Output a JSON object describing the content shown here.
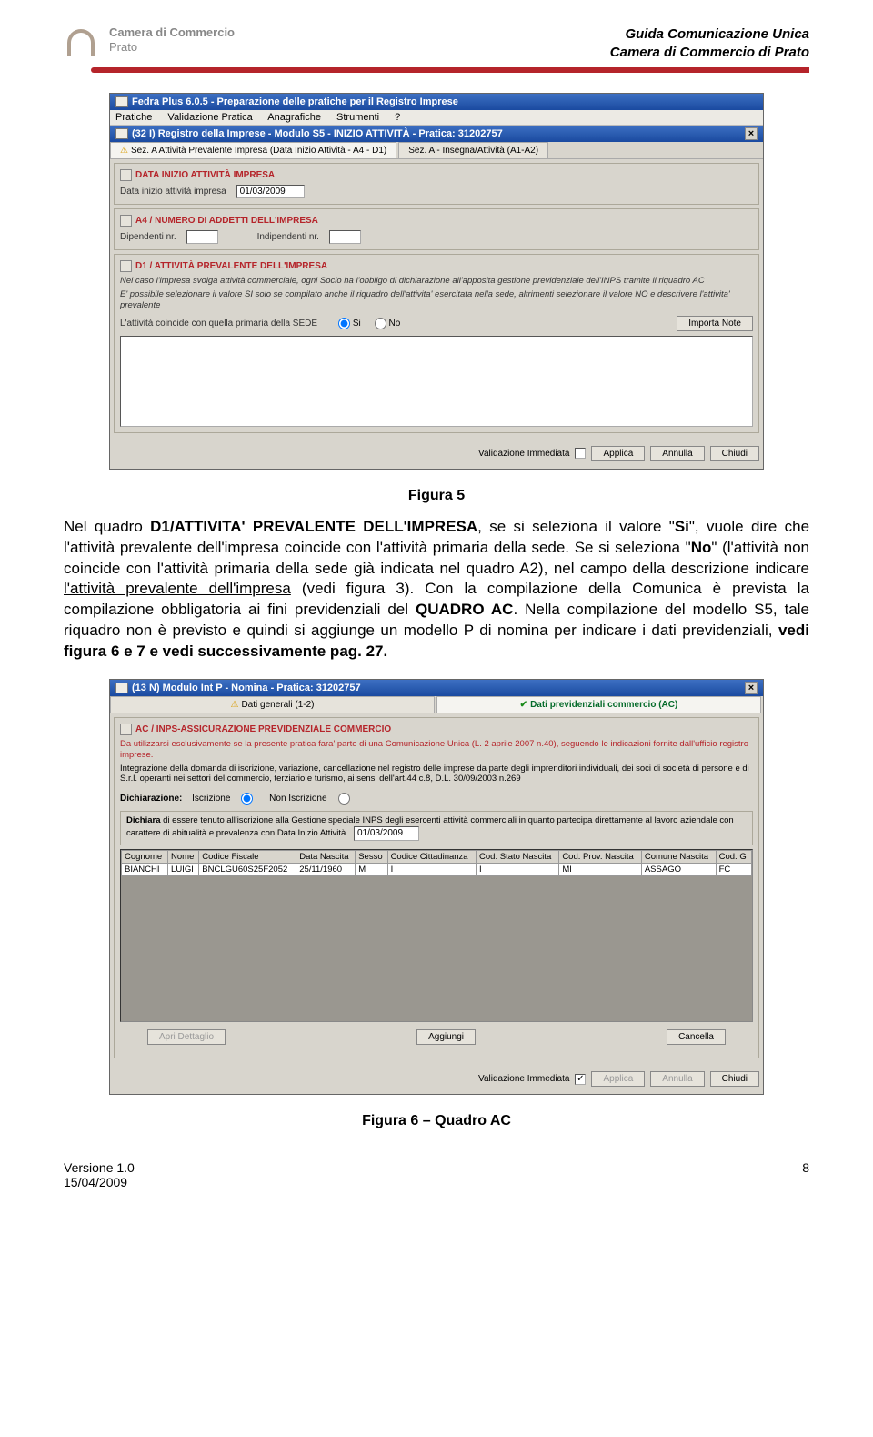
{
  "header": {
    "logo_line1": "Camera di Commercio",
    "logo_line2": "Prato",
    "right_line1": "Guida Comunicazione Unica",
    "right_line2": "Camera di Commercio di Prato"
  },
  "fig5": {
    "win_title": "Fedra Plus 6.0.5 - Preparazione delle pratiche per il Registro Imprese",
    "menu": [
      "Pratiche",
      "Validazione Pratica",
      "Anagrafiche",
      "Strumenti",
      "?"
    ],
    "sub_title": "(32 I) Registro della Imprese - Modulo S5 - INIZIO ATTIVITÀ - Pratica: 31202757",
    "tabs": [
      "Sez. A Attività Prevalente Impresa (Data Inizio Attività - A4 - D1)",
      "Sez. A - Insegna/Attività (A1-A2)"
    ],
    "panel1": {
      "title": "DATA INIZIO ATTIVITÀ IMPRESA",
      "label": "Data inizio attività impresa",
      "value": "01/03/2009"
    },
    "panel2": {
      "title": "A4 / NUMERO DI ADDETTI DELL'IMPRESA",
      "label1": "Dipendenti nr.",
      "label2": "Indipendenti nr."
    },
    "panel3": {
      "title": "D1 / ATTIVITÀ PREVALENTE DELL'IMPRESA",
      "note1": "Nel caso l'impresa svolga attività commerciale, ogni Socio ha l'obbligo di dichiarazione all'apposita gestione previdenziale dell'INPS tramite il riquadro AC",
      "note2": "E' possibile selezionare il valore SI solo se compilato anche il riquadro dell'attivita' esercitata nella sede, altrimenti selezionare il valore NO e descrivere l'attivita' prevalente",
      "prompt": "L'attività coincide con quella primaria della SEDE",
      "opt_si": "Si",
      "opt_no": "No",
      "import_btn": "Importa Note"
    },
    "bottom": {
      "valida": "Validazione Immediata",
      "applica": "Applica",
      "annulla": "Annulla",
      "chiudi": "Chiudi"
    },
    "caption": "Figura 5"
  },
  "body": {
    "p1a": "Nel quadro ",
    "p1b": "D1/ATTIVITA' PREVALENTE DELL'IMPRESA",
    "p1c": ", se si seleziona  il valore ",
    "p1d": "Si",
    "p1e": ", vuole dire che l'attività prevalente dell'impresa coincide con l'attività primaria della sede. Se si seleziona ",
    "p1f": "No",
    "p1g": " (l'attività non coincide con l'attività primaria della sede già indicata nel quadro A2), nel campo della descrizione indicare ",
    "p1h": "l'attività prevalente dell'impresa",
    "p1i": " (vedi figura 3). Con la compilazione della Comunica è prevista la compilazione obbligatoria ai fini previdenziali del ",
    "p1j": "QUADRO AC",
    "p1k": ". Nella compilazione del modello S5, tale riquadro non è previsto e quindi si aggiunge un modello P di nomina per indicare i dati previdenziali, ",
    "p1l": "vedi figura 6 e 7 e vedi successivamente pag. 27."
  },
  "fig6": {
    "sub_title": "(13 N) Modulo Int P - Nomina - Pratica: 31202757",
    "tabs": [
      "Dati generali (1-2)",
      "Dati previdenziali commercio (AC)"
    ],
    "panel_title": "AC / INPS-ASSICURAZIONE PREVIDENZIALE COMMERCIO",
    "red_note": "Da utilizzarsi esclusivamente se la presente pratica fara' parte di una Comunicazione Unica (L. 2 aprile 2007 n.40), seguendo le indicazioni fornite dall'ufficio registro imprese.",
    "black_note": "Integrazione della domanda di iscrizione, variazione, cancellazione nel registro delle imprese da parte degli imprenditori individuali, dei soci di società di persone e di S.r.l. operanti nei settori del commercio, terziario e turismo, ai sensi dell'art.44 c.8, D.L. 30/09/2003 n.269",
    "dich_label": "Dichiarazione:",
    "dich_opt1": "Iscrizione",
    "dich_opt2": "Non Iscrizione",
    "dichiara_lbl": "Dichiara",
    "dichiara_txt": "di essere tenuto all'iscrizione alla Gestione speciale INPS degli esercenti attività commerciali in quanto partecipa direttamente al lavoro aziendale con carattere di abitualità e prevalenza con Data Inizio Attività",
    "dichiara_date": "01/03/2009",
    "tbl_headers": [
      "Cognome",
      "Nome",
      "Codice Fiscale",
      "Data Nascita",
      "Sesso",
      "Codice Cittadinanza",
      "Cod. Stato Nascita",
      "Cod. Prov. Nascita",
      "Comune Nascita",
      "Cod. G"
    ],
    "tbl_row": [
      "BIANCHI",
      "LUIGI",
      "BNCLGU60S25F2052",
      "25/11/1960",
      "M",
      "I",
      "I",
      "MI",
      "ASSAGO",
      "FC"
    ],
    "btn_detail": "Apri Dettaglio",
    "btn_add": "Aggiungi",
    "btn_del": "Cancella",
    "bottom": {
      "valida": "Validazione Immediata",
      "applica": "Applica",
      "annulla": "Annulla",
      "chiudi": "Chiudi"
    },
    "caption": "Figura 6 – Quadro AC"
  },
  "footer": {
    "ver": "Versione 1.0",
    "date": "15/04/2009",
    "page": "8"
  }
}
